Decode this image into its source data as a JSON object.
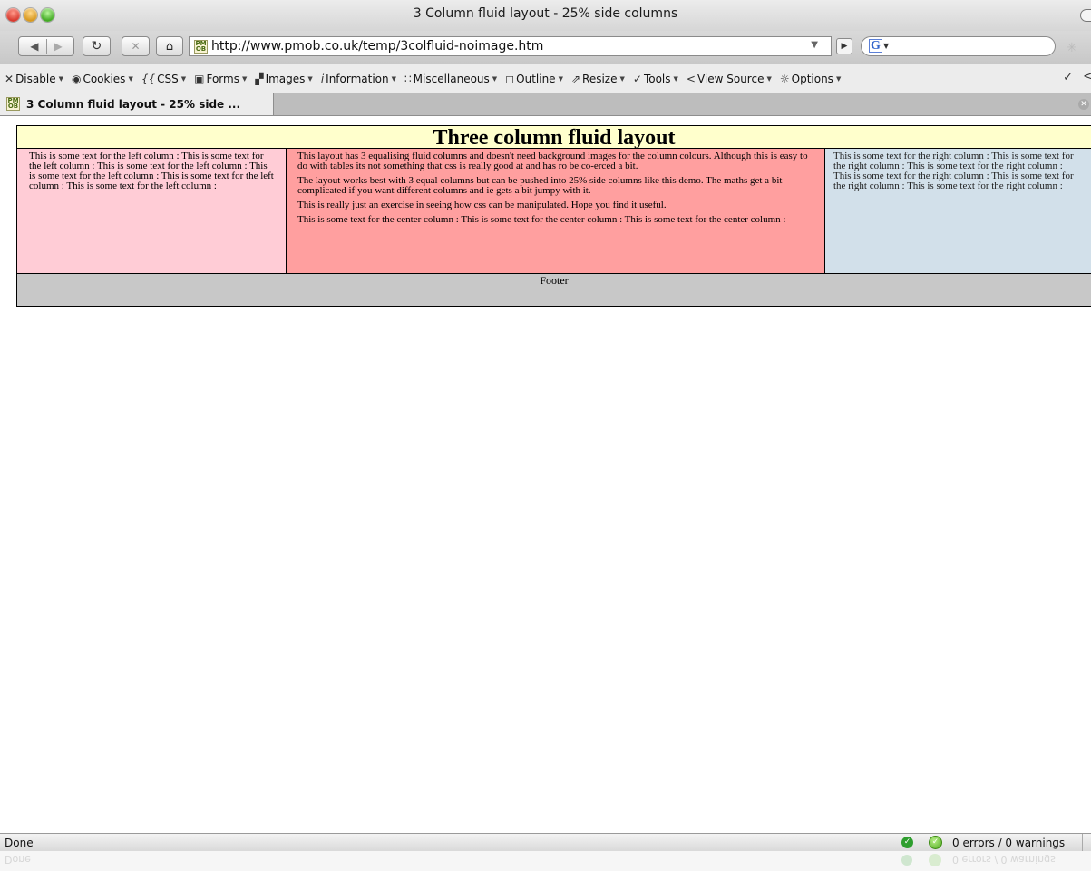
{
  "window": {
    "title": "3 Column fluid layout - 25% side columns"
  },
  "toolbar": {
    "url": "http://www.pmob.co.uk/temp/3colfluid-noimage.htm",
    "search_engine_letter": "G"
  },
  "webdev": {
    "items": [
      {
        "label": "Disable",
        "icon": "close-icon"
      },
      {
        "label": "Cookies",
        "icon": "eye-icon"
      },
      {
        "label": "CSS",
        "icon": "css-icon"
      },
      {
        "label": "Forms",
        "icon": "lock-icon"
      },
      {
        "label": "Images",
        "icon": "image-icon"
      },
      {
        "label": "Information",
        "icon": "info-icon"
      },
      {
        "label": "Miscellaneous",
        "icon": "grid-icon"
      },
      {
        "label": "Outline",
        "icon": "outline-icon"
      },
      {
        "label": "Resize",
        "icon": "resize-icon"
      },
      {
        "label": "Tools",
        "icon": "check-icon"
      },
      {
        "label": "View Source",
        "icon": "source-icon"
      },
      {
        "label": "Options",
        "icon": "gear-icon"
      }
    ]
  },
  "tab": {
    "label": "3 Column fluid layout - 25% side ..."
  },
  "page": {
    "heading": "Three column fluid layout",
    "left_column": "This is some text for the left column : This is some text for the left column : This is some text for the left column : This is some text for the left column : This is some text for the left column : This is some text for the left column :",
    "center_paragraphs": [
      "This layout has 3 equalising fluid columns and doesn't need background images for the column colours. Although this is easy to do with tables its not something that css is really good at and has ro be co-erced a bit.",
      "The layout works best with 3 equal columns but can be pushed into 25% side columns like this demo. The maths get a bit complicated if you want different columns and ie gets a bit jumpy with it.",
      "This is really just an exercise in seeing how css can be manipulated. Hope you find it useful.",
      "This is some text for the center column : This is some text for the center column : This is some text for the center column :"
    ],
    "right_column": "This is some text for the right column : This is some text for the right column : This is some text for the right column : This is some text for the right column : This is some text for the right column : This is some text for the right column :",
    "footer": "Footer"
  },
  "statusbar": {
    "status": "Done",
    "validator": "0 errors / 0 warnings"
  },
  "colors": {
    "header_bg": "#ffffcc",
    "left_bg": "#ffccd6",
    "center_bg": "#ff9f9f",
    "right_bg": "#d2e0ea",
    "footer_bg": "#c8c8c8"
  }
}
